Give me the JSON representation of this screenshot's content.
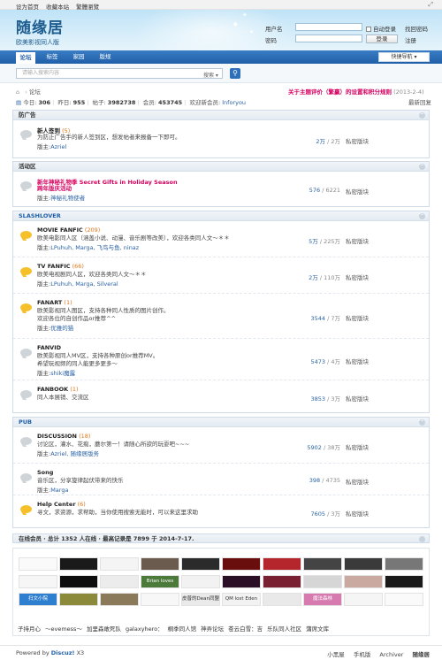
{
  "topbar": {
    "links": [
      "设为首页",
      "收藏本站",
      "繁體瀏覽"
    ],
    "collapse_icon": "resize-icon"
  },
  "header": {
    "logo_title": "随缘居",
    "logo_subtitle": "欧美影视同人版"
  },
  "login": {
    "username_label": "用户名",
    "password_label": "密码",
    "auto_login_label": "自动登录",
    "forgot_label": "找回密码",
    "login_button": "登录",
    "register_label": "注册"
  },
  "nav": {
    "tabs": [
      "论坛",
      "标签",
      "家园",
      "版规"
    ],
    "quick_nav": "快捷导航 ▾"
  },
  "search": {
    "placeholder": "请输入搜索内容",
    "type_select": "搜索 ▾"
  },
  "breadcrumb": {
    "current": "论坛"
  },
  "notice": {
    "text": "关于主题评价（繁赢）的设置和积分规则",
    "date": "(2013-2-4)"
  },
  "stats": {
    "today_label": "今日:",
    "today": "306",
    "yesterday_label": "昨日:",
    "yesterday": "955",
    "posts_label": "帖子:",
    "posts": "3982738",
    "members_label": "会员:",
    "members": "453745",
    "welcome_label": "欢迎新会员:",
    "newest_member": "lnforyou",
    "latest_link": "最新回复"
  },
  "categories": [
    {
      "title": "防广告",
      "blue": false,
      "forums": [
        {
          "name": "新人签到",
          "count": "(5)",
          "desc": [
            "为防止广告手的新人签到区，想发帖者来报备一下即可。"
          ],
          "mod_label": "版主:",
          "mods": "Azriel",
          "today": "2万",
          "total": "2万",
          "private": "私密版块",
          "icon": "grey"
        }
      ]
    },
    {
      "title": "活动区",
      "blue": false,
      "forums": [
        {
          "name": "新年神秘礼物季 Secret Gifts in Holiday Season",
          "count": "",
          "desc": [
            "跨年版庆活动"
          ],
          "mod_label": "版主:",
          "mods": "神秘礼物使者",
          "today": "576",
          "total": "6221",
          "private": "私密版块",
          "icon": "grey",
          "pink": true
        }
      ]
    },
    {
      "title": "SLASHLOVER",
      "blue": true,
      "forums": [
        {
          "name": "MOVIE FANFIC",
          "count": "(209)",
          "desc": [
            "欧美电影同人区（涵盖小说、动漫、音乐剧等改美），欢迎各类同人文～＊＊"
          ],
          "mod_label": "版主:",
          "mods": "LPuhuh, Marga, 飞鸟与鱼, ninaz",
          "today": "5万",
          "total": "225万",
          "private": "私密版块",
          "icon": "yellow"
        },
        {
          "name": "TV FANFIC",
          "count": "(66)",
          "desc": [
            "欧美电视剧同人区，欢迎各类同人文～＊＊"
          ],
          "mod_label": "版主:",
          "mods": "LPuhuh, Marga, Silveral",
          "today": "2万",
          "total": "110万",
          "private": "私密版块",
          "icon": "yellow"
        },
        {
          "name": "FANART",
          "count": "(1)",
          "desc": [
            "欧美影视同人图区，支持各种同人性质的图片创作。",
            "欢迎各位的自创作品or推荐^^"
          ],
          "mod_label": "版主:",
          "mods": "优雅的猫",
          "today": "3544",
          "total": "7万",
          "private": "私密版块",
          "icon": "yellow"
        },
        {
          "name": "FANVID",
          "count": "",
          "desc": [
            "欧美影视同人MV区，支持各种原创or推荐MV。",
            "希望玩视频的同人能更多更多～"
          ],
          "mod_label": "版主:",
          "mods": "shiki魔露",
          "today": "5473",
          "total": "4万",
          "private": "私密版块",
          "icon": "grey"
        },
        {
          "name": "FANBOOK",
          "count": "(1)",
          "desc": [
            "同人本展销、交流区"
          ],
          "mod_label": "",
          "mods": "",
          "today": "3853",
          "total": "3万",
          "private": "私密版块",
          "icon": "grey"
        }
      ]
    },
    {
      "title": "PUB",
      "blue": true,
      "forums": [
        {
          "name": "DISCUSSION",
          "count": "(18)",
          "desc": [
            "讨论区，灌水、花痴，蘑尔第一！请随心所欲的玩耍吧~~~"
          ],
          "mod_label": "版主:",
          "mods": "Azriel, 随缘居版务",
          "today": "5902",
          "total": "38万",
          "private": "私密版块",
          "icon": "grey"
        },
        {
          "name": "Song",
          "count": "",
          "desc": [
            "音乐区，分享旋律起伏带来的快乐"
          ],
          "mod_label": "版主:",
          "mods": "Marga",
          "today": "398",
          "total": "4735",
          "private": "私密版块",
          "icon": "grey"
        },
        {
          "name": "Help Center",
          "count": "(6)",
          "desc": [
            "寻文，求资源，求帮助，当你使用搜索无能时，可以来这里求助"
          ],
          "mod_label": "",
          "mods": "",
          "today": "7605",
          "total": "3万",
          "private": "私密版块",
          "icon": "yellow"
        }
      ]
    }
  ],
  "online": {
    "text": "在线会员 · 总计 1352 人在线 · 最高记录是 7899 于 2014-7-17."
  },
  "friend_links": {
    "banners": [
      "",
      "",
      "",
      "",
      "",
      "",
      "",
      "",
      "",
      "",
      "",
      "",
      "",
      "Brian loves Justin",
      "",
      "",
      "",
      "",
      "",
      "",
      "扫文小院",
      "",
      "",
      "",
      "皮普的Dean同盟",
      "QM lost Eden",
      "",
      "魔法森林",
      "",
      ""
    ],
    "names": [
      "子持月心",
      "～evemess～",
      "加里森敢死队",
      "galaxyhero：",
      "桐季同人馆",
      "神弄论坛",
      "苍云白雪：吉",
      "乐队同人社区",
      "蒲席文库"
    ]
  },
  "footer": {
    "powered": "Powered by",
    "brand": "Discuz!",
    "version": "X3",
    "links": [
      "小黑屋",
      "手机版",
      "Archiver",
      "随缘居"
    ]
  }
}
